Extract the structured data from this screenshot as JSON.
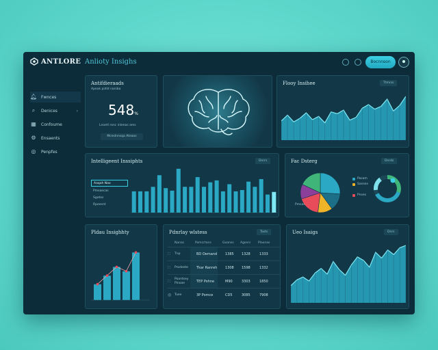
{
  "header": {
    "brand": "ANTLORE",
    "title": "Anlioty Insighs",
    "action_button": "Bocnnson"
  },
  "sidebar": {
    "items": [
      {
        "label": "Fwnces",
        "icon": "bell-icon"
      },
      {
        "label": "Denices",
        "icon": "search-icon"
      },
      {
        "label": "Confoume",
        "icon": "calendar-icon"
      },
      {
        "label": "Ensaents",
        "icon": "settings-icon"
      },
      {
        "label": "Penpfes",
        "icon": "globe-icon"
      }
    ]
  },
  "kpi_card": {
    "title": "Antifdieraads",
    "subtitle": "Apeak pidld naniba",
    "value": "548",
    "unit": "%",
    "caption": "Lnoetl ronc inlenas ams",
    "button": "Mceslnnsqa Ateaos"
  },
  "flow_card": {
    "title": "Flooy Insihee",
    "chip": "Ttmrss"
  },
  "analytics_card": {
    "title": "Intelligeent Inssiphts",
    "chip": "Dnrrs",
    "list": [
      "Aaqoh Nao",
      "Pmsaecas",
      "Sgotos",
      "Rpoesnt"
    ]
  },
  "distribution_card": {
    "title": "Fac Dsterg",
    "chip": "Dnrds",
    "legend": [
      "Pmsas",
      "Pnas",
      "Pnas",
      "Anam"
    ],
    "legend_right": [
      "Pasam",
      "Sanses",
      "Pnses"
    ]
  },
  "trend_card": {
    "title": "Pldau Insighhty"
  },
  "table_card": {
    "title": "Pdnrlay wlstess",
    "chip": "Tasts",
    "headers": [
      "Nanac",
      "Pomcrtans",
      "Goanss",
      "Agsers",
      "Plaxnas"
    ],
    "rows": [
      {
        "label": "Tnp",
        "a": "BD Oemand",
        "b": "1385",
        "c": "1328",
        "d": "1333"
      },
      {
        "label": "Prodeete",
        "a": "Tkar Ranreh",
        "b": "1308",
        "c": "1598",
        "d": "1332"
      },
      {
        "label": "Poantsey Pinoae",
        "a": "TEP Pohne",
        "b": "M90",
        "c": "3303",
        "d": "1850"
      },
      {
        "label": "Tuee",
        "a": "3P Pomce",
        "b": "CD5",
        "c": "3085",
        "d": "7908"
      }
    ]
  },
  "area_card": {
    "title": "Ueo Isaigs",
    "chip": "Dnrs"
  },
  "chart_data": [
    {
      "type": "area",
      "title": "Flooy Insihee",
      "values": [
        42,
        55,
        40,
        48,
        60,
        45,
        52,
        38,
        62,
        58,
        66,
        44,
        50,
        70,
        78,
        68,
        74,
        90,
        64,
        76,
        96
      ]
    },
    {
      "type": "bar",
      "title": "Intelligeent Inssiphts",
      "values": [
        33,
        33,
        33,
        40,
        58,
        38,
        34,
        68,
        40,
        40,
        55,
        40,
        47,
        50,
        33,
        44,
        33,
        35,
        48,
        40,
        52,
        28,
        32
      ]
    },
    {
      "type": "pie",
      "title": "Fac Dsterg",
      "values": [
        26,
        14,
        12,
        18,
        12,
        18
      ],
      "colors": [
        "#2aa8c4",
        "#1c6f87",
        "#f0b429",
        "#e84b5a",
        "#8b3f9a",
        "#3fb57a"
      ]
    },
    {
      "type": "bar",
      "title": "Pldau Insighhty",
      "values": [
        22,
        34,
        46,
        40,
        66
      ]
    },
    {
      "type": "area",
      "title": "Ueo Isaigs",
      "values": [
        30,
        40,
        45,
        38,
        52,
        60,
        50,
        72,
        58,
        48,
        66,
        80,
        74,
        62,
        88,
        78,
        92,
        84,
        96,
        100
      ]
    }
  ]
}
